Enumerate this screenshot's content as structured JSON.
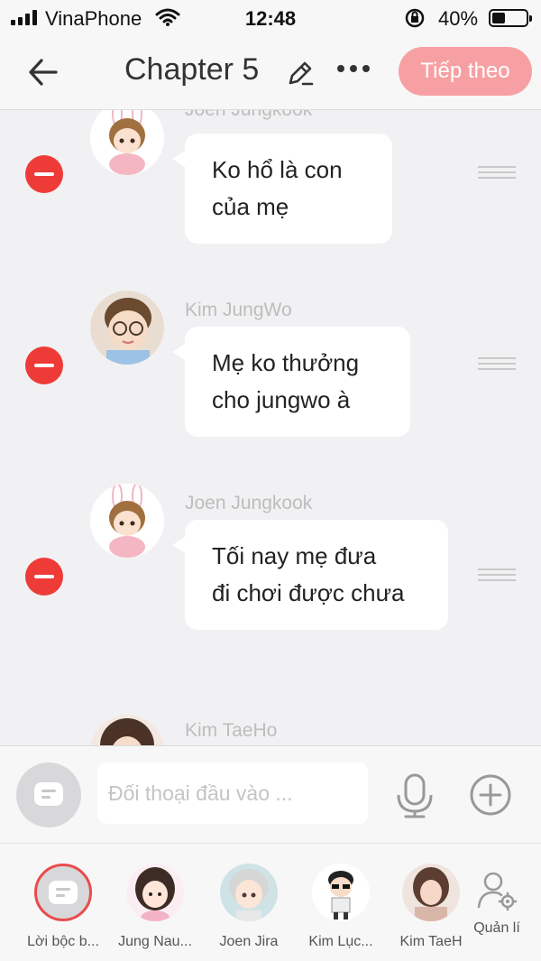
{
  "status_bar": {
    "carrier": "VinaPhone",
    "time": "12:48",
    "battery_percent": "40%",
    "battery_level": 0.4
  },
  "header": {
    "title": "Chapter 5",
    "next_label": "Tiếp theo",
    "accent_color": "#f7a0a3"
  },
  "messages": [
    {
      "sender": "Joen Jungkook",
      "text_line1": "Ko hổ là con",
      "text_line2": "của mẹ",
      "avatar": "bunny-boy-avatar"
    },
    {
      "sender": "Kim JungWo",
      "text_line1": "Mẹ ko thưởng",
      "text_line2": "cho jungwo à",
      "avatar": "glasses-kid-avatar"
    },
    {
      "sender": "Joen Jungkook",
      "text_line1": "Tối nay mẹ đưa",
      "text_line2": "đi chơi được chưa",
      "avatar": "bunny-boy-avatar"
    },
    {
      "sender": "Kim TaeHo",
      "avatar": "girl-avatar"
    }
  ],
  "input": {
    "placeholder": "Đối thoại đầu vào ..."
  },
  "characters": [
    {
      "name": "Lời bộc b...",
      "icon": "narration-icon"
    },
    {
      "name": "Jung Nau...",
      "icon": "girl-char-avatar"
    },
    {
      "name": "Joen Jira",
      "icon": "silver-hair-avatar"
    },
    {
      "name": "Kim Lục...",
      "icon": "sunglasses-avatar"
    },
    {
      "name": "Kim TaeH",
      "icon": "photo-girl-avatar"
    },
    {
      "name": "Quản lí",
      "icon": "manage-user-icon"
    }
  ],
  "colors": {
    "remove": "#ee3b37",
    "background": "#f1f1f3"
  }
}
